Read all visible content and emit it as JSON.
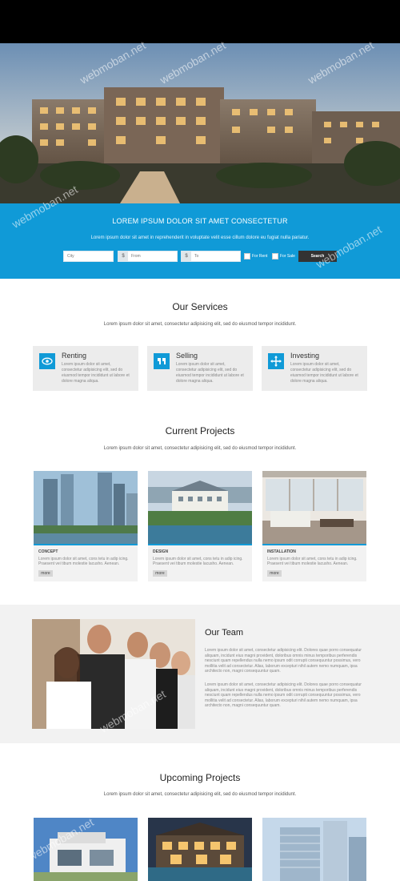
{
  "search": {
    "title": "LOREM IPSUM DOLOR SIT AMET CONSECTETUR",
    "subtitle": "Lorem ipsum dolor sit amet in reprehenderit in voluptate velit esse cillum dolore eu fugiat nulla pariatur.",
    "city_placeholder": "City",
    "from_prefix": "$",
    "from_placeholder": "From",
    "to_prefix": "$",
    "to_placeholder": "To",
    "for_rent_label": "For Rent",
    "for_sale_label": "For Sale",
    "button_label": "Search"
  },
  "services": {
    "title": "Our Services",
    "lead": "Lorem ipsum dolor sit amet, consectetur adipisicing elit, sed do eiusmod tempor incididunt.",
    "items": [
      {
        "icon": "eye-icon",
        "title": "Renting",
        "text": "Lorem ipsum dolor sit amet, consectetur adipisicing elit, sed do eiusmod tempor incididunt ut labore et dolore magna aliqua."
      },
      {
        "icon": "quote-icon",
        "title": "Selling",
        "text": "Lorem ipsum dolor sit amet, consectetur adipisicing elit, sed do eiusmod tempor incididunt ut labore et dolore magna aliqua."
      },
      {
        "icon": "move-arrows-icon",
        "title": "Investing",
        "text": "Lorem ipsum dolor sit amet, consectetur adipisicing elit, sed do eiusmod tempor incididunt ut labore et dolore magna aliqua."
      }
    ]
  },
  "projects": {
    "title": "Current Projects",
    "lead": "Lorem ipsum dolor sit amet, consectetur adipisicing elit, sed do eiusmod tempor incididunt.",
    "items": [
      {
        "category": "CONCEPT",
        "text": "Lorem ipsum dolor sit amet, cons tetu in adip icing. Praesent vei tibum molestie lacusho. Aenean.",
        "more": "more"
      },
      {
        "category": "DESIGN",
        "text": "Lorem ipsum dolor sit amet, cons tetu in adip icing. Praesent vei tibum molestie lacusho. Aenean.",
        "more": "more"
      },
      {
        "category": "INSTALLATION",
        "text": "Lorem ipsum dolor sit amet, cons tetu in adip icing. Praesent vei tibum molestie lacusho. Aenean.",
        "more": "more"
      }
    ]
  },
  "team": {
    "title": "Our Team",
    "para1": "Lorem ipsum dolor sit amet, consectetur adipisicing elit. Dolores quae porro consequatur aliquam, incidunt eius magni provident, doloribus omnis minus temporibus perferendis nesciunt quam repellendus nulla nemo ipsum odit corrupti consequuntur possimus, vero mollitia velit ad consectetur. Alias, laborum excepturi nihil autem nemo numquam, ipsa architecto non, magni consequuntur quam.",
    "para2": "Lorem ipsum dolor sit amet, consectetur adipisicing elit. Dolores quae porro consequatur aliquam, incidunt eius magni provident, doloribus omnis minus temporibus perferendis nesciunt quam repellendus nulla nemo ipsum odit corrupti consequuntur possimus, vero mollitia velit ad consectetur. Alias, laborum excepturi nihil autem nemo numquam, ipsa architecto non, magni consequuntur quam."
  },
  "upcoming": {
    "title": "Upcoming Projects",
    "lead": "Lorem ipsum dolor sit amet, consectetur adipisicing elit, sed do eiusmod tempor incididunt."
  },
  "watermark": "webmoban.net",
  "colors": {
    "accent": "#109ad7",
    "dark": "#333333",
    "panel": "#ececec"
  }
}
